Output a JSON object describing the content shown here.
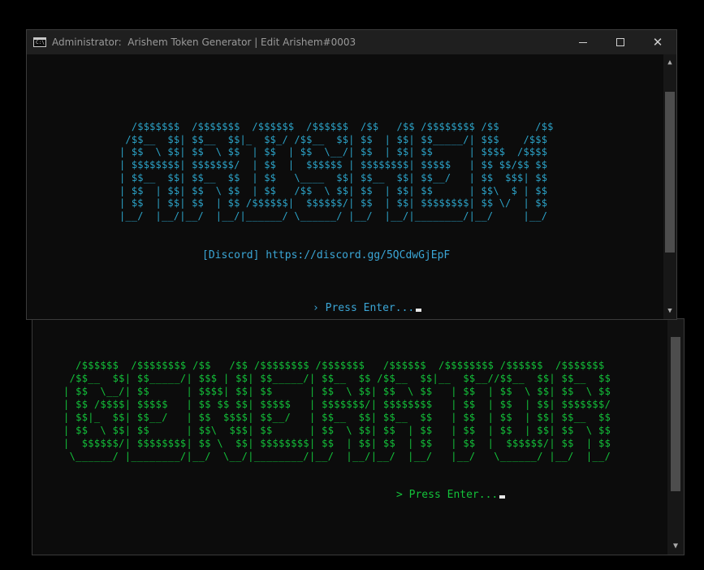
{
  "window_back": {
    "ascii_art": "  /$$$$$$  /$$$$$$$$ /$$   /$$ /$$$$$$$$ /$$$$$$$   /$$$$$$  /$$$$$$$$ /$$$$$$  /$$$$$$$ \n /$$__  $$| $$_____/| $$$ | $$| $$_____/| $$__  $$ /$$__  $$|__  $$__//$$__  $$| $$__  $$\n| $$  \\__/| $$      | $$$$| $$| $$      | $$  \\ $$| $$  \\ $$   | $$  | $$  \\ $$| $$  \\ $$\n| $$ /$$$$| $$$$$   | $$ $$ $$| $$$$$   | $$$$$$$/| $$$$$$$$   | $$  | $$  | $$| $$$$$$$/\n| $$|_  $$| $$__/   | $$  $$$$| $$__/   | $$__  $$| $$__  $$   | $$  | $$  | $$| $$__  $$\n| $$  \\ $$| $$      | $$\\  $$$| $$      | $$  \\ $$| $$  | $$   | $$  | $$  | $$| $$  \\ $$\n|  $$$$$$/| $$$$$$$$| $$ \\  $$| $$$$$$$$| $$  | $$| $$  | $$   | $$  |  $$$$$$/| $$  | $$\n \\______/ |________/|__/  \\__/|________/|__/  |__/|__/  |__/   |__/   \\______/ |__/  |__/",
    "prompt": "> Press Enter...",
    "color": "#13c23a"
  },
  "window_front": {
    "title": "Administrator:  Arishem Token Generator | Edit Arishem#0003",
    "app_icon_text": "C:\\",
    "controls": {
      "minimize": "minimize-icon",
      "maximize": "maximize-icon",
      "close": "✕"
    },
    "ascii_art": "  /$$$$$$$  /$$$$$$$  /$$$$$$  /$$$$$$  /$$   /$$ /$$$$$$$$ /$$      /$$\n /$$__  $$| $$__  $$|_  $$_/ /$$__  $$| $$  | $$| $$_____/| $$$    /$$$\n| $$  \\ $$| $$  \\ $$  | $$  | $$  \\__/| $$  | $$| $$      | $$$$  /$$$$\n| $$$$$$$$| $$$$$$$/  | $$  |  $$$$$$ | $$$$$$$$| $$$$$   | $$ $$/$$ $$\n| $$__  $$| $$__  $$  | $$   \\____  $$| $$__  $$| $$__/   | $$  $$$| $$\n| $$  | $$| $$  \\ $$  | $$   /$$  \\ $$| $$  | $$| $$      | $$\\  $ | $$\n| $$  | $$| $$  | $$ /$$$$$$|  $$$$$$/| $$  | $$| $$$$$$$$| $$ \\/  | $$\n|__/  |__/|__/  |__/|______/ \\______/ |__/  |__/|________/|__/     |__/",
    "discord_text": "[Discord] https://discord.gg/5QCdwGjEpF",
    "prompt": "› Press Enter...",
    "color": "#2ca3c8"
  }
}
